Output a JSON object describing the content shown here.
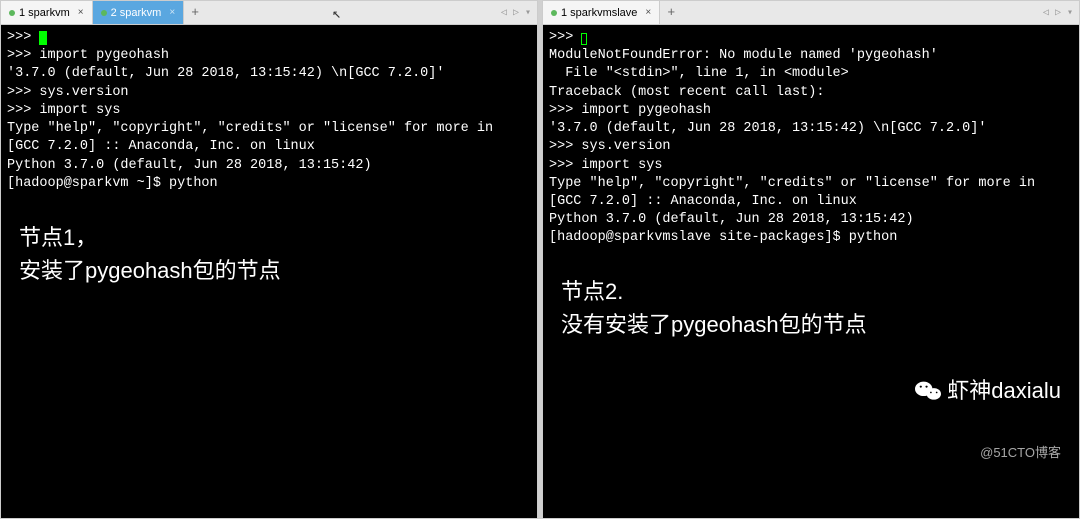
{
  "left": {
    "tabs": [
      {
        "label": "1 sparkvm",
        "active": false
      },
      {
        "label": "2 sparkvm",
        "active": true
      }
    ],
    "terminal_lines": [
      "",
      "[hadoop@sparkvm ~]$ python",
      "Python 3.7.0 (default, Jun 28 2018, 13:15:42)",
      "[GCC 7.2.0] :: Anaconda, Inc. on linux",
      "Type \"help\", \"copyright\", \"credits\" or \"license\" for more in",
      ">>> import sys",
      ">>> sys.version",
      "'3.7.0 (default, Jun 28 2018, 13:15:42) \\n[GCC 7.2.0]'",
      ">>> import pygeohash",
      ">>> "
    ],
    "annotation": "节点1，\n安装了pygeohash包的节点"
  },
  "right": {
    "tabs": [
      {
        "label": "1 sparkvmslave",
        "active": false
      }
    ],
    "terminal_lines": [
      "",
      "[hadoop@sparkvmslave site-packages]$ python",
      "Python 3.7.0 (default, Jun 28 2018, 13:15:42)",
      "[GCC 7.2.0] :: Anaconda, Inc. on linux",
      "Type \"help\", \"copyright\", \"credits\" or \"license\" for more in",
      ">>> import sys",
      ">>> sys.version",
      "'3.7.0 (default, Jun 28 2018, 13:15:42) \\n[GCC 7.2.0]'",
      ">>> import pygeohash",
      "Traceback (most recent call last):",
      "  File \"<stdin>\", line 1, in <module>",
      "ModuleNotFoundError: No module named 'pygeohash'",
      ">>> "
    ],
    "annotation": "节点2.\n没有安装了pygeohash包的节点"
  },
  "signature": {
    "main": "虾神daxialu",
    "sub": "@51CTO博客"
  },
  "glyphs": {
    "add": "+",
    "chev_left": "◁",
    "chev_right": "▷",
    "menu": "▾",
    "close": "×"
  }
}
